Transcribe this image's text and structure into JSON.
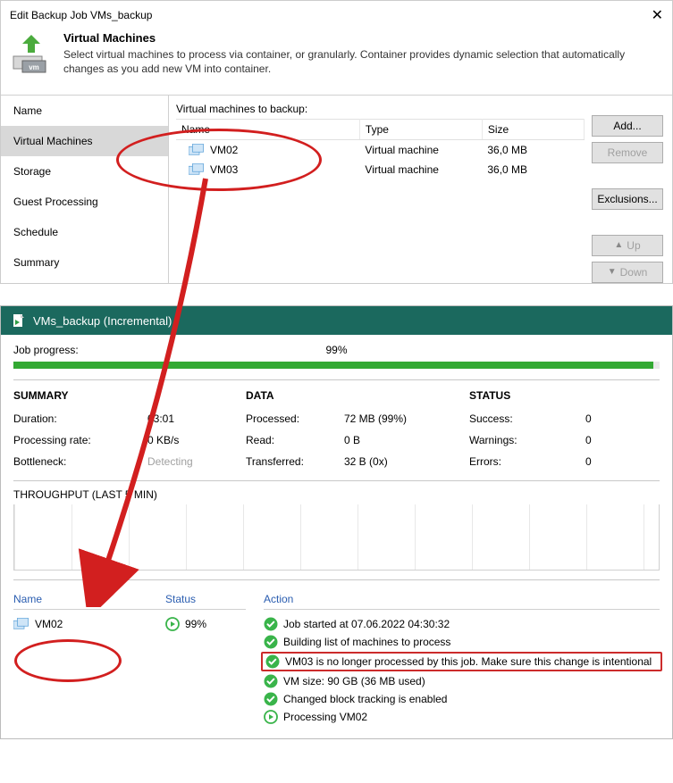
{
  "dialog": {
    "title": "Edit Backup Job VMs_backup",
    "header_h2": "Virtual Machines",
    "header_p": "Select virtual machines to process via container, or granularly. Container provides dynamic selection that automatically changes as you add new VM into container.",
    "nav": [
      "Name",
      "Virtual Machines",
      "Storage",
      "Guest Processing",
      "Schedule",
      "Summary"
    ],
    "selected_nav_index": 1,
    "content_label": "Virtual machines to backup:",
    "columns": [
      "Name",
      "Type",
      "Size"
    ],
    "rows": [
      {
        "name": "VM02",
        "type": "Virtual machine",
        "size": "36,0 MB"
      },
      {
        "name": "VM03",
        "type": "Virtual machine",
        "size": "36,0 MB"
      }
    ],
    "buttons": {
      "add": "Add...",
      "remove": "Remove",
      "exclusions": "Exclusions...",
      "up": "Up",
      "down": "Down"
    }
  },
  "status": {
    "title": "VMs_backup (Incremental)",
    "progress_label": "Job progress:",
    "progress_value": "99%",
    "summary_hd": "SUMMARY",
    "summary": {
      "duration_k": "Duration:",
      "duration_v": "03:01",
      "rate_k": "Processing rate:",
      "rate_v": "0 KB/s",
      "bottleneck_k": "Bottleneck:",
      "bottleneck_v": "Detecting"
    },
    "data_hd": "DATA",
    "data": {
      "processed_k": "Processed:",
      "processed_v": "72 MB (99%)",
      "read_k": "Read:",
      "read_v": "0 B",
      "transferred_k": "Transferred:",
      "transferred_v": "32 B (0x)"
    },
    "status_hd": "STATUS",
    "stat": {
      "success_k": "Success:",
      "success_v": "0",
      "warnings_k": "Warnings:",
      "warnings_v": "0",
      "errors_k": "Errors:",
      "errors_v": "0"
    },
    "throughput_label": "THROUGHPUT (LAST 5 MIN)",
    "bottom_heads": {
      "name": "Name",
      "status": "Status",
      "action": "Action"
    },
    "bottom_row": {
      "name": "VM02",
      "status": "99%"
    },
    "actions": [
      "Job started at 07.06.2022 04:30:32",
      "Building list of machines to process",
      "VM03 is no longer processed by this job. Make sure this change is intentional",
      "VM size: 90 GB (36 MB used)",
      "Changed block tracking is enabled",
      "Processing VM02"
    ]
  }
}
